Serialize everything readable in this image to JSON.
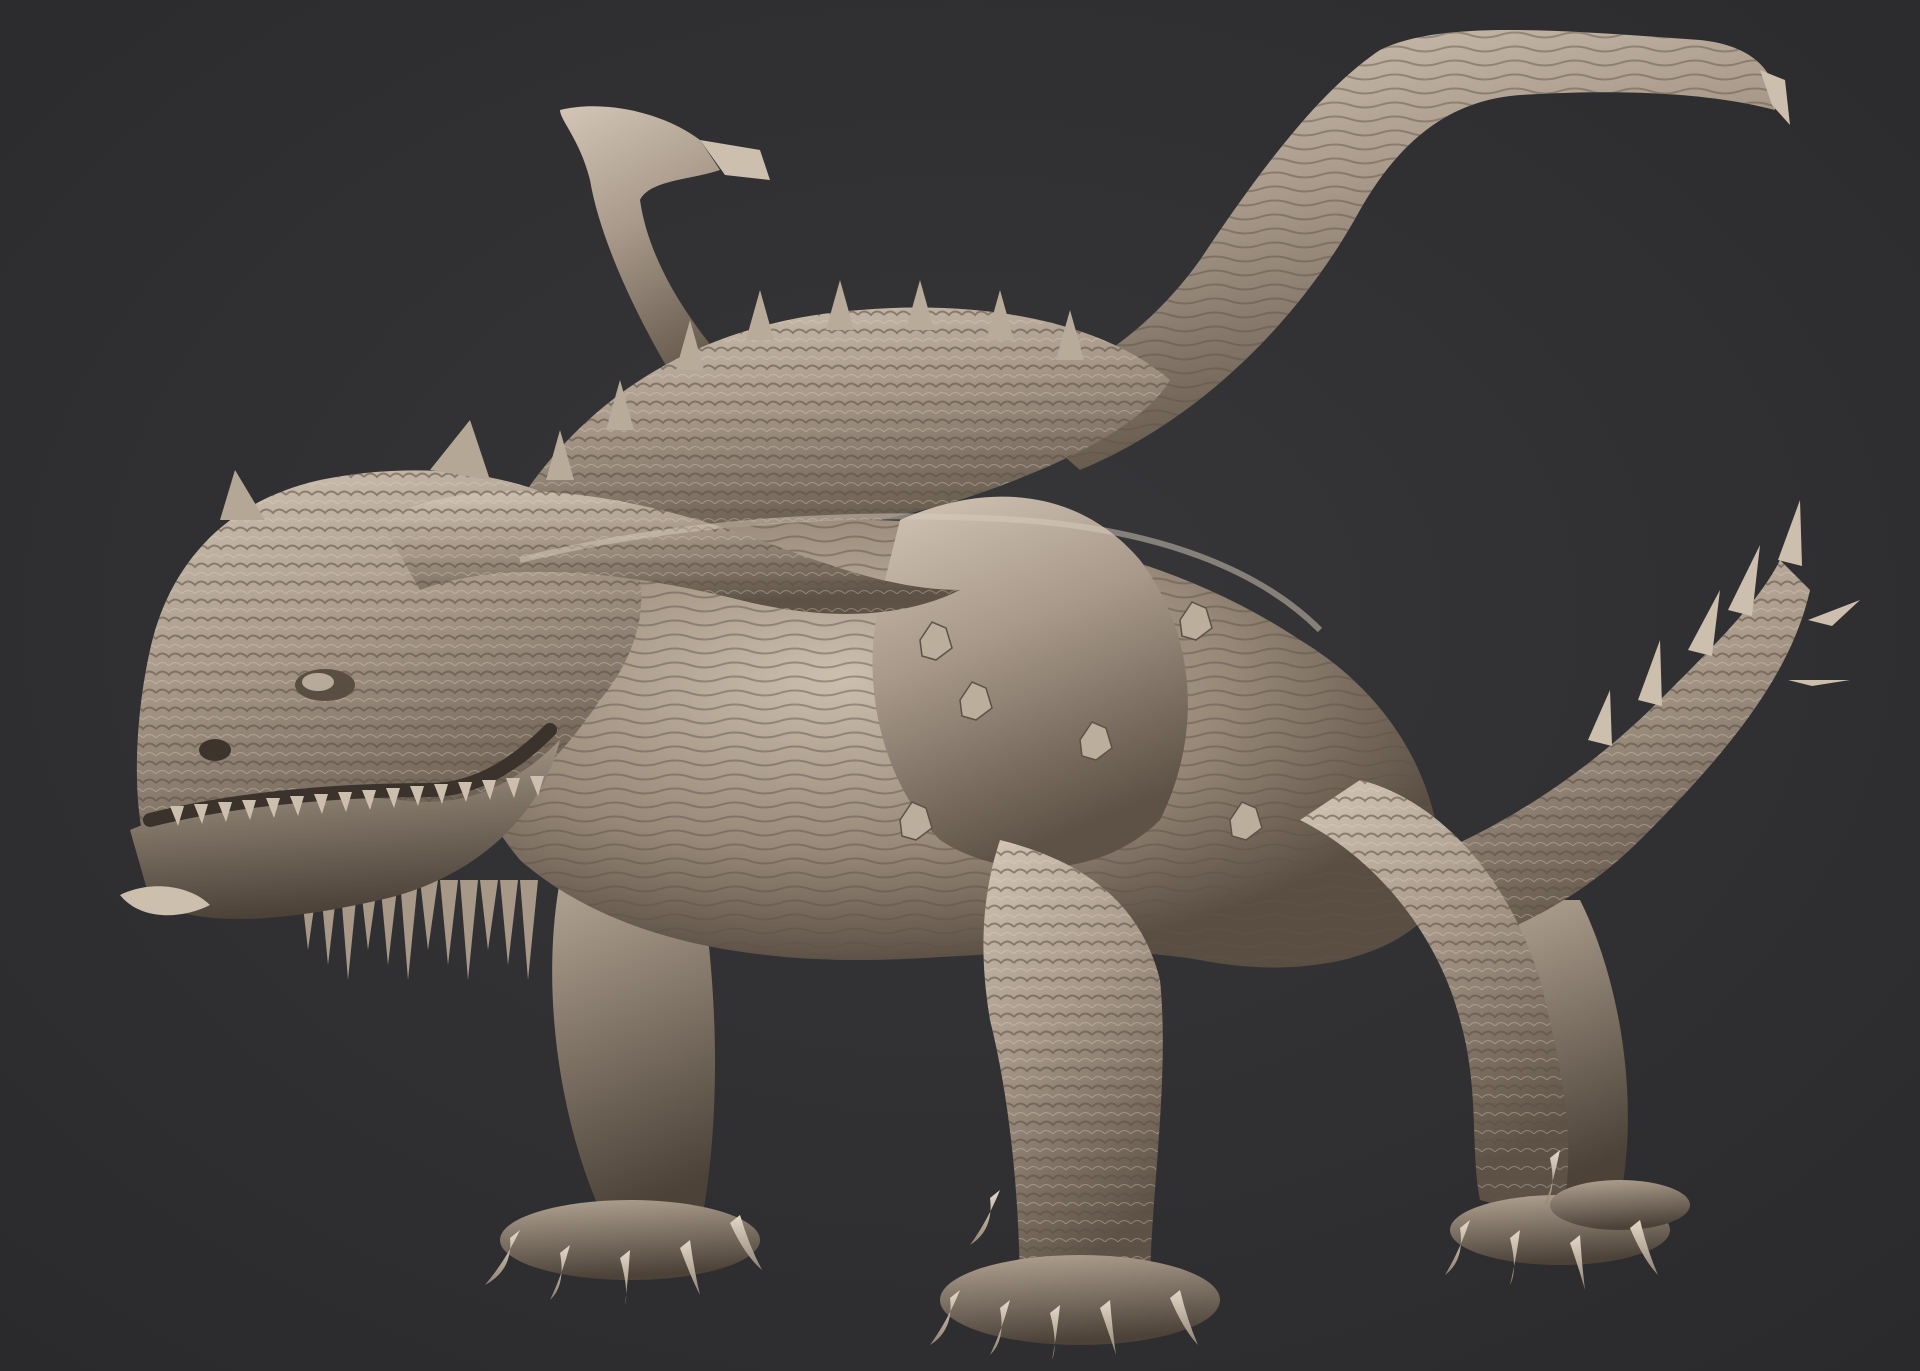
{
  "scene": {
    "subject": "sculpted-clay-dragon",
    "background_color": "#2f2f31",
    "clay_base_color": "#9a8b7b",
    "clay_highlight_color": "#d8ccbc",
    "clay_shadow_color": "#4a4036",
    "claw_color": "#cdbfae"
  }
}
